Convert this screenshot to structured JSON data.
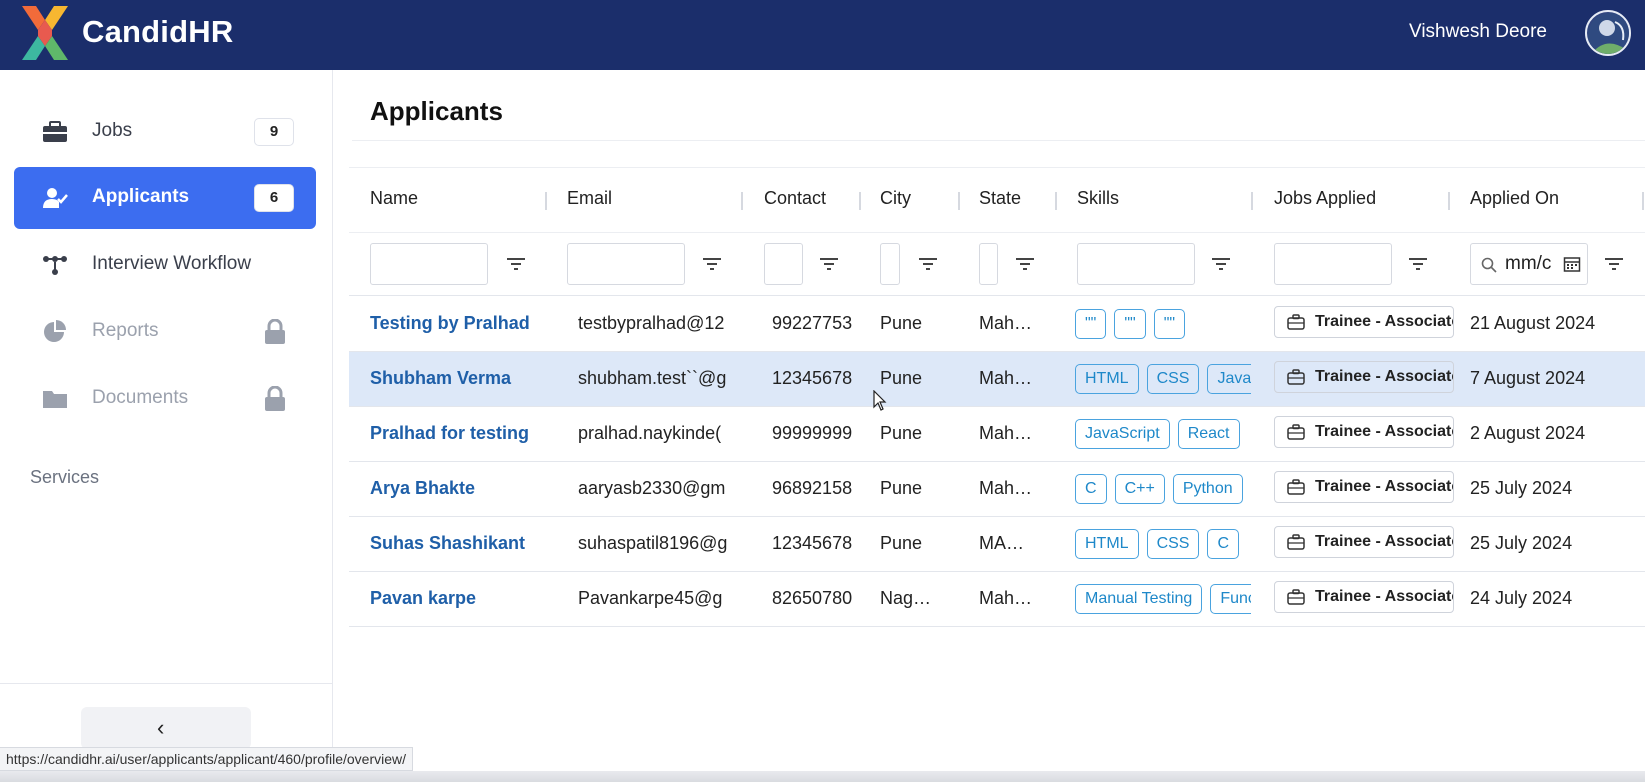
{
  "header": {
    "brand": "CandidHR",
    "user_name": "Vishwesh Deore",
    "avatar_icon": "user-avatar-icon",
    "brand_color": "#1b2e6b"
  },
  "sidebar": {
    "items": [
      {
        "label": "Jobs",
        "badge": "9",
        "icon": "briefcase-icon"
      },
      {
        "label": "Applicants",
        "badge": "6",
        "icon": "user-check-icon"
      },
      {
        "label": "Interview Workflow",
        "icon": "workflow-icon"
      },
      {
        "label": "Reports",
        "icon": "pie-chart-icon",
        "locked": true
      },
      {
        "label": "Documents",
        "icon": "folder-icon",
        "locked": true
      }
    ],
    "section_label": "Services",
    "collapse_icon": "chevron-left-icon",
    "active_color": "#3c6df0"
  },
  "main": {
    "title": "Applicants",
    "columns": [
      "Name",
      "Email",
      "Contact",
      "City",
      "State",
      "Skills",
      "Jobs Applied",
      "Applied On"
    ],
    "date_filter_placeholder": "mm/c",
    "rows": [
      {
        "name": "Testing by Pralhad",
        "email": "testbypralhad@12",
        "contact": "99227753",
        "city": "Pune",
        "state": "Maharashtra",
        "skills": [
          "\"\"",
          "\"\"",
          "\"\""
        ],
        "job": "Trainee - Associate",
        "applied_on": "21 August 2024"
      },
      {
        "name": "Shubham Verma",
        "email": "shubham.test``@g",
        "contact": "12345678",
        "city": "Pune",
        "state": "Maharashtra",
        "skills": [
          "HTML",
          "CSS",
          "JavaScript"
        ],
        "job": "Trainee - Associate",
        "applied_on": "7 August 2024"
      },
      {
        "name": "Pralhad for testing",
        "email": "pralhad.naykinde(",
        "contact": "99999999",
        "city": "Pune",
        "state": "Maharashtra",
        "skills": [
          "JavaScript",
          "React"
        ],
        "job": "Trainee - Associate",
        "applied_on": "2 August 2024"
      },
      {
        "name": "Arya Bhakte",
        "email": "aaryasb2330@gm",
        "contact": "96892158",
        "city": "Pune",
        "state": "Maharashtra",
        "skills": [
          "C",
          "C++",
          "Python"
        ],
        "job": "Trainee - Associate",
        "applied_on": "25 July 2024"
      },
      {
        "name": "Suhas Shashikant",
        "email": "suhaspatil8196@g",
        "contact": "12345678",
        "city": "Pune",
        "state": "MAHARASHTRA",
        "skills": [
          "HTML",
          "CSS",
          "C"
        ],
        "job": "Trainee - Associate",
        "applied_on": "25 July 2024"
      },
      {
        "name": "Pavan karpe",
        "email": "Pavankarpe45@g",
        "contact": "82650780",
        "city": "Nagpur",
        "state": "Maharashtra",
        "skills": [
          "Manual Testing",
          "Functional"
        ],
        "job": "Trainee - Associate",
        "applied_on": "24 July 2024"
      }
    ]
  },
  "status_bar": {
    "url": "https://candidhr.ai/user/applicants/applicant/460/profile/overview/"
  }
}
